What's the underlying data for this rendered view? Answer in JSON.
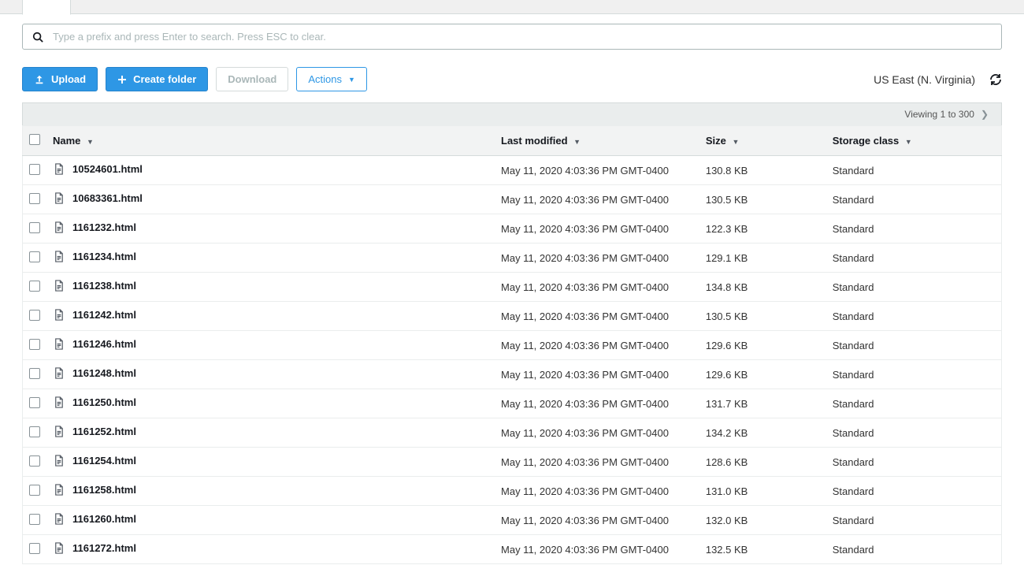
{
  "search": {
    "placeholder": "Type a prefix and press Enter to search. Press ESC to clear."
  },
  "toolbar": {
    "upload_label": "Upload",
    "create_folder_label": "Create folder",
    "download_label": "Download",
    "actions_label": "Actions"
  },
  "region": "US East (N. Virginia)",
  "paging": "Viewing 1 to 300",
  "columns": {
    "name": "Name",
    "modified": "Last modified",
    "size": "Size",
    "storage": "Storage class"
  },
  "rows": [
    {
      "name": "10524601.html",
      "modified": "May 11, 2020 4:03:36 PM GMT-0400",
      "size": "130.8 KB",
      "storage": "Standard"
    },
    {
      "name": "10683361.html",
      "modified": "May 11, 2020 4:03:36 PM GMT-0400",
      "size": "130.5 KB",
      "storage": "Standard"
    },
    {
      "name": "1161232.html",
      "modified": "May 11, 2020 4:03:36 PM GMT-0400",
      "size": "122.3 KB",
      "storage": "Standard"
    },
    {
      "name": "1161234.html",
      "modified": "May 11, 2020 4:03:36 PM GMT-0400",
      "size": "129.1 KB",
      "storage": "Standard"
    },
    {
      "name": "1161238.html",
      "modified": "May 11, 2020 4:03:36 PM GMT-0400",
      "size": "134.8 KB",
      "storage": "Standard"
    },
    {
      "name": "1161242.html",
      "modified": "May 11, 2020 4:03:36 PM GMT-0400",
      "size": "130.5 KB",
      "storage": "Standard"
    },
    {
      "name": "1161246.html",
      "modified": "May 11, 2020 4:03:36 PM GMT-0400",
      "size": "129.6 KB",
      "storage": "Standard"
    },
    {
      "name": "1161248.html",
      "modified": "May 11, 2020 4:03:36 PM GMT-0400",
      "size": "129.6 KB",
      "storage": "Standard"
    },
    {
      "name": "1161250.html",
      "modified": "May 11, 2020 4:03:36 PM GMT-0400",
      "size": "131.7 KB",
      "storage": "Standard"
    },
    {
      "name": "1161252.html",
      "modified": "May 11, 2020 4:03:36 PM GMT-0400",
      "size": "134.2 KB",
      "storage": "Standard"
    },
    {
      "name": "1161254.html",
      "modified": "May 11, 2020 4:03:36 PM GMT-0400",
      "size": "128.6 KB",
      "storage": "Standard"
    },
    {
      "name": "1161258.html",
      "modified": "May 11, 2020 4:03:36 PM GMT-0400",
      "size": "131.0 KB",
      "storage": "Standard"
    },
    {
      "name": "1161260.html",
      "modified": "May 11, 2020 4:03:36 PM GMT-0400",
      "size": "132.0 KB",
      "storage": "Standard"
    },
    {
      "name": "1161272.html",
      "modified": "May 11, 2020 4:03:36 PM GMT-0400",
      "size": "132.5 KB",
      "storage": "Standard"
    }
  ]
}
